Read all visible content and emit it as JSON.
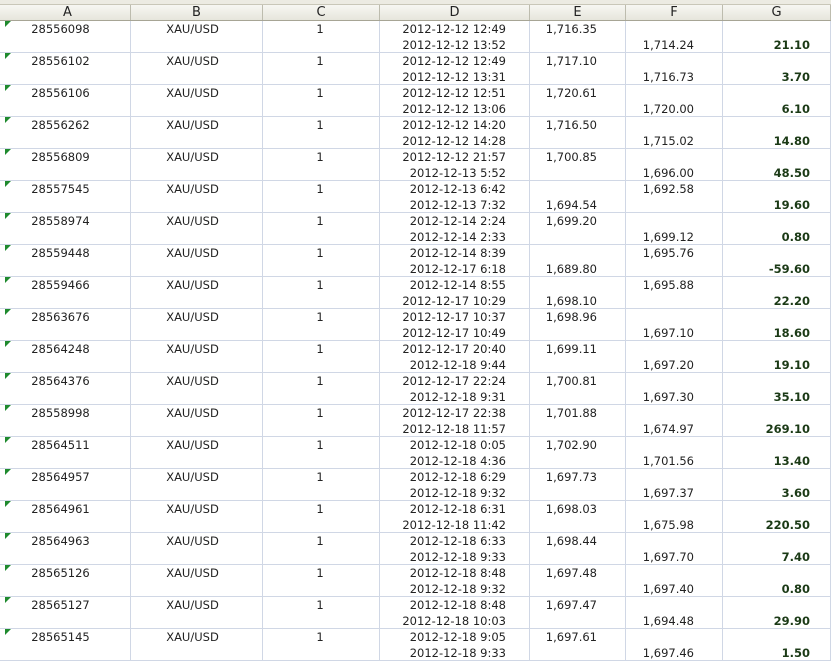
{
  "columns": [
    "A",
    "B",
    "C",
    "D",
    "E",
    "F",
    "G"
  ],
  "rows": [
    {
      "id": "28556098",
      "symbol": "XAU/USD",
      "qty": "1",
      "d1": "2012-12-12 12:49",
      "d2": "2012-12-12 13:52",
      "e1": "1,716.35",
      "e2": "",
      "f1": "",
      "f2": "1,714.24",
      "g": "21.10"
    },
    {
      "id": "28556102",
      "symbol": "XAU/USD",
      "qty": "1",
      "d1": "2012-12-12 12:49",
      "d2": "2012-12-12 13:31",
      "e1": "1,717.10",
      "e2": "",
      "f1": "",
      "f2": "1,716.73",
      "g": "3.70"
    },
    {
      "id": "28556106",
      "symbol": "XAU/USD",
      "qty": "1",
      "d1": "2012-12-12 12:51",
      "d2": "2012-12-12 13:06",
      "e1": "1,720.61",
      "e2": "",
      "f1": "",
      "f2": "1,720.00",
      "g": "6.10"
    },
    {
      "id": "28556262",
      "symbol": "XAU/USD",
      "qty": "1",
      "d1": "2012-12-12 14:20",
      "d2": "2012-12-12 14:28",
      "e1": "1,716.50",
      "e2": "",
      "f1": "",
      "f2": "1,715.02",
      "g": "14.80"
    },
    {
      "id": "28556809",
      "symbol": "XAU/USD",
      "qty": "1",
      "d1": "2012-12-12 21:57",
      "d2": "2012-12-13 5:52",
      "e1": "1,700.85",
      "e2": "",
      "f1": "",
      "f2": "1,696.00",
      "g": "48.50"
    },
    {
      "id": "28557545",
      "symbol": "XAU/USD",
      "qty": "1",
      "d1": "2012-12-13 6:42",
      "d2": "2012-12-13 7:32",
      "e1": "",
      "e2": "1,694.54",
      "f1": "1,692.58",
      "f2": "",
      "g": "19.60"
    },
    {
      "id": "28558974",
      "symbol": "XAU/USD",
      "qty": "1",
      "d1": "2012-12-14 2:24",
      "d2": "2012-12-14 2:33",
      "e1": "1,699.20",
      "e2": "",
      "f1": "",
      "f2": "1,699.12",
      "g": "0.80"
    },
    {
      "id": "28559448",
      "symbol": "XAU/USD",
      "qty": "1",
      "d1": "2012-12-14 8:39",
      "d2": "2012-12-17 6:18",
      "e1": "",
      "e2": "1,689.80",
      "f1": "1,695.76",
      "f2": "",
      "g": "-59.60"
    },
    {
      "id": "28559466",
      "symbol": "XAU/USD",
      "qty": "1",
      "d1": "2012-12-14 8:55",
      "d2": "2012-12-17 10:29",
      "e1": "",
      "e2": "1,698.10",
      "f1": "1,695.88",
      "f2": "",
      "g": "22.20"
    },
    {
      "id": "28563676",
      "symbol": "XAU/USD",
      "qty": "1",
      "d1": "2012-12-17 10:37",
      "d2": "2012-12-17 10:49",
      "e1": "1,698.96",
      "e2": "",
      "f1": "",
      "f2": "1,697.10",
      "g": "18.60"
    },
    {
      "id": "28564248",
      "symbol": "XAU/USD",
      "qty": "1",
      "d1": "2012-12-17 20:40",
      "d2": "2012-12-18 9:44",
      "e1": "1,699.11",
      "e2": "",
      "f1": "",
      "f2": "1,697.20",
      "g": "19.10"
    },
    {
      "id": "28564376",
      "symbol": "XAU/USD",
      "qty": "1",
      "d1": "2012-12-17 22:24",
      "d2": "2012-12-18 9:31",
      "e1": "1,700.81",
      "e2": "",
      "f1": "",
      "f2": "1,697.30",
      "g": "35.10"
    },
    {
      "id": "28558998",
      "symbol": "XAU/USD",
      "qty": "1",
      "d1": "2012-12-17 22:38",
      "d2": "2012-12-18 11:57",
      "e1": "1,701.88",
      "e2": "",
      "f1": "",
      "f2": "1,674.97",
      "g": "269.10"
    },
    {
      "id": "28564511",
      "symbol": "XAU/USD",
      "qty": "1",
      "d1": "2012-12-18 0:05",
      "d2": "2012-12-18 4:36",
      "e1": "1,702.90",
      "e2": "",
      "f1": "",
      "f2": "1,701.56",
      "g": "13.40"
    },
    {
      "id": "28564957",
      "symbol": "XAU/USD",
      "qty": "1",
      "d1": "2012-12-18 6:29",
      "d2": "2012-12-18 9:32",
      "e1": "1,697.73",
      "e2": "",
      "f1": "",
      "f2": "1,697.37",
      "g": "3.60"
    },
    {
      "id": "28564961",
      "symbol": "XAU/USD",
      "qty": "1",
      "d1": "2012-12-18 6:31",
      "d2": "2012-12-18 11:42",
      "e1": "1,698.03",
      "e2": "",
      "f1": "",
      "f2": "1,675.98",
      "g": "220.50"
    },
    {
      "id": "28564963",
      "symbol": "XAU/USD",
      "qty": "1",
      "d1": "2012-12-18 6:33",
      "d2": "2012-12-18 9:33",
      "e1": "1,698.44",
      "e2": "",
      "f1": "",
      "f2": "1,697.70",
      "g": "7.40"
    },
    {
      "id": "28565126",
      "symbol": "XAU/USD",
      "qty": "1",
      "d1": "2012-12-18 8:48",
      "d2": "2012-12-18 9:32",
      "e1": "1,697.48",
      "e2": "",
      "f1": "",
      "f2": "1,697.40",
      "g": "0.80"
    },
    {
      "id": "28565127",
      "symbol": "XAU/USD",
      "qty": "1",
      "d1": "2012-12-18 8:48",
      "d2": "2012-12-18 10:03",
      "e1": "1,697.47",
      "e2": "",
      "f1": "",
      "f2": "1,694.48",
      "g": "29.90"
    },
    {
      "id": "28565145",
      "symbol": "XAU/USD",
      "qty": "1",
      "d1": "2012-12-18 9:05",
      "d2": "2012-12-18 9:33",
      "e1": "1,697.61",
      "e2": "",
      "f1": "",
      "f2": "1,697.46",
      "g": "1.50"
    }
  ],
  "colors": {
    "header_bg": "#e6e5dc",
    "gridline": "#d0d7e5",
    "error_flag": "#1f8a2e",
    "profit_text": "#1b3a16"
  },
  "icons": [
    "error-indicator-icon"
  ]
}
